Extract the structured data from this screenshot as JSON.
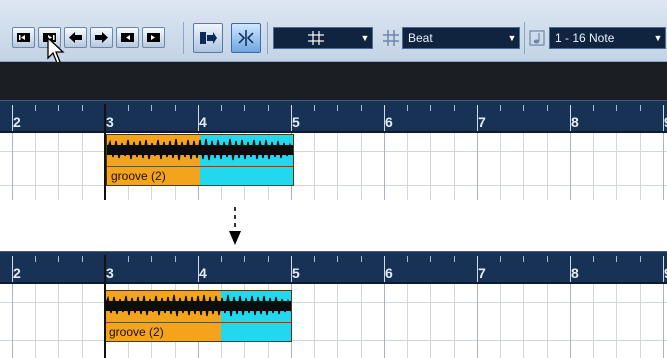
{
  "toolbar": {
    "transport_buttons": [
      {
        "name": "go-to-start-icon"
      },
      {
        "name": "go-to-end-icon"
      },
      {
        "name": "previous-event-icon"
      },
      {
        "name": "next-event-icon"
      },
      {
        "name": "locate-left-icon"
      },
      {
        "name": "locate-right-icon"
      }
    ],
    "snap_button": "snap-to-grid-icon",
    "snap_active_button": "snap-zero-crossing-icon",
    "snap_type_dropdown": {
      "value": "",
      "icon": "grid-icon"
    },
    "grid_type_dropdown": {
      "value": "Beat"
    },
    "quantize_dropdown": {
      "value": "1 - 16 Note"
    }
  },
  "ruler_labels": [
    "2",
    "3",
    "4",
    "5",
    "6",
    "7",
    "8",
    "9"
  ],
  "event_top": {
    "name": "groove (2)"
  },
  "event_bottom": {
    "name": "groove (2)"
  },
  "colors": {
    "event_selected": "#f4a31c",
    "event_audio": "#22d8ee",
    "ruler_bg": "#183256",
    "dark_bar": "#1b1e22"
  }
}
